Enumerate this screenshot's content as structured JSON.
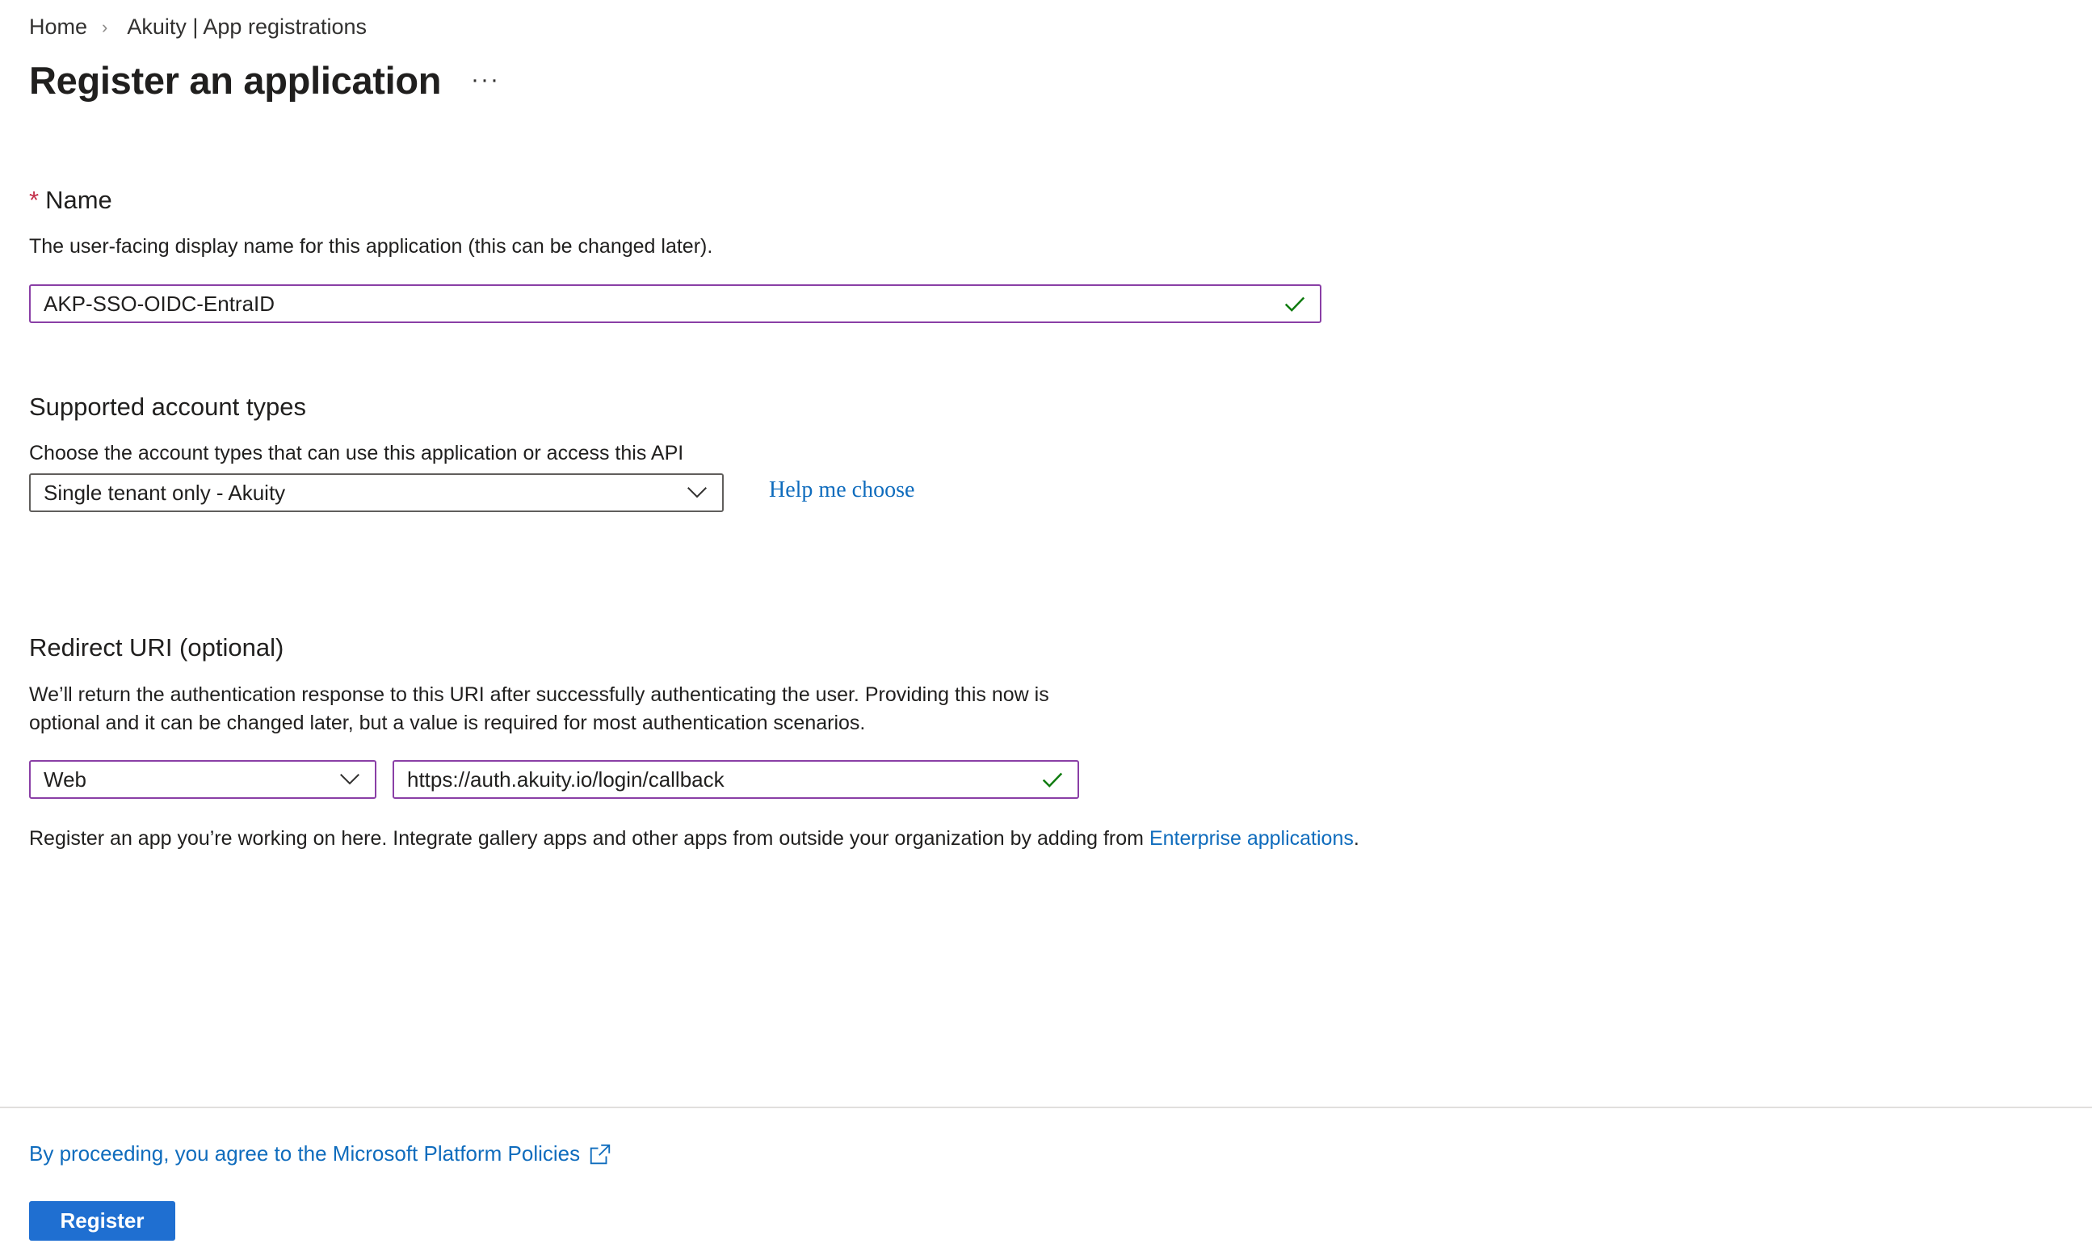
{
  "breadcrumb": {
    "home": "Home",
    "current": "Akuity | App registrations"
  },
  "page": {
    "title": "Register an application",
    "more": "···"
  },
  "name_section": {
    "required_mark": "*",
    "label": "Name",
    "description": "The user-facing display name for this application (this can be changed later).",
    "value": "AKP-SSO-OIDC-EntraID"
  },
  "account_types": {
    "label": "Supported account types",
    "description": "Choose the account types that can use this application or access this API",
    "selected": "Single tenant only - Akuity",
    "help_link": "Help me choose"
  },
  "redirect": {
    "label": "Redirect URI (optional)",
    "description_line1": "We’ll return the authentication response to this URI after successfully authenticating the user. Providing this now is",
    "description_line2": "optional and it can be changed later, but a value is required for most authentication scenarios.",
    "platform": "Web",
    "uri": "https://auth.akuity.io/login/callback"
  },
  "info": {
    "text": "Register an app you’re working on here. Integrate gallery apps and other apps from outside your organization by adding from ",
    "link": "Enterprise applications",
    "suffix": "."
  },
  "footer": {
    "policy_link": "By proceeding, you agree to the Microsoft Platform Policies",
    "register_button": "Register"
  },
  "colors": {
    "accent": "#1f6fd1",
    "link": "#0f6cbd",
    "focus_border": "#8a3fa6",
    "valid": "#107c10",
    "required": "#c4314b"
  },
  "icons": {
    "breadcrumb_separator": "chevron-right-icon",
    "valid": "checkmark-icon",
    "dropdown": "chevron-down-icon",
    "external": "open-in-new-icon"
  }
}
